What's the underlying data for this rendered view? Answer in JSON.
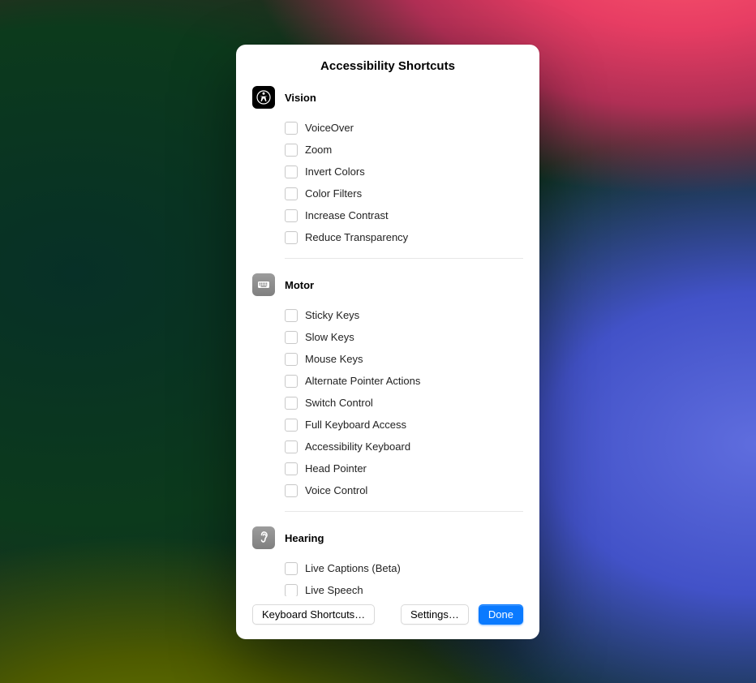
{
  "title": "Accessibility Shortcuts",
  "sections": [
    {
      "id": "vision",
      "title": "Vision",
      "icon": "accessibility-icon",
      "options": [
        "VoiceOver",
        "Zoom",
        "Invert Colors",
        "Color Filters",
        "Increase Contrast",
        "Reduce Transparency"
      ]
    },
    {
      "id": "motor",
      "title": "Motor",
      "icon": "keyboard-icon",
      "options": [
        "Sticky Keys",
        "Slow Keys",
        "Mouse Keys",
        "Alternate Pointer Actions",
        "Switch Control",
        "Full Keyboard Access",
        "Accessibility Keyboard",
        "Head Pointer",
        "Voice Control"
      ]
    },
    {
      "id": "hearing",
      "title": "Hearing",
      "icon": "ear-icon",
      "options": [
        "Live Captions (Beta)",
        "Live Speech"
      ]
    }
  ],
  "footer": {
    "keyboard_shortcuts": "Keyboard Shortcuts…",
    "settings": "Settings…",
    "done": "Done"
  }
}
